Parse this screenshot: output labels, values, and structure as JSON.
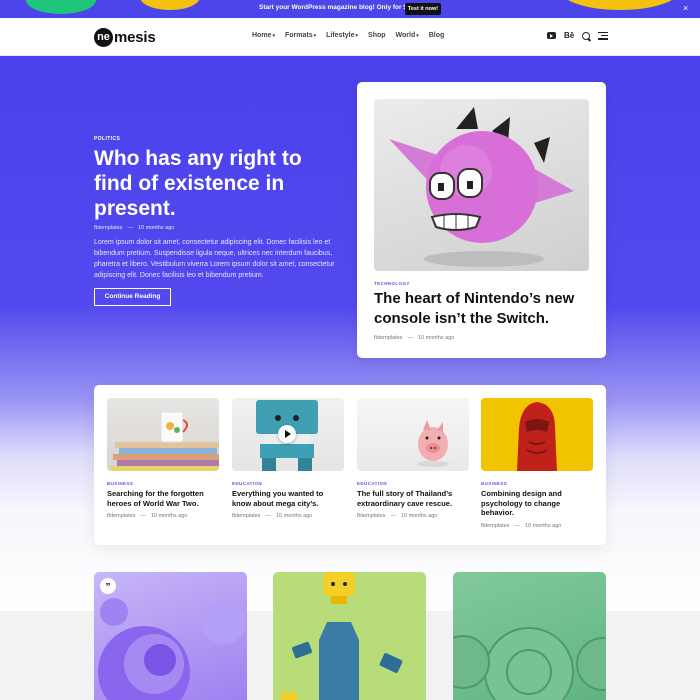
{
  "topbar": {
    "text": "Start your WordPress magazine blog! Only for $59",
    "button": "Test it now!",
    "close": "×"
  },
  "header": {
    "logo_mark": "ne",
    "logo_rest": "mesis",
    "nav": [
      "Home",
      "Formats",
      "Lifestyle",
      "Shop",
      "World",
      "Blog"
    ],
    "icons": [
      "youtube-icon",
      "behance-icon",
      "search-icon",
      "menu-icon"
    ],
    "behance_text": "Bē"
  },
  "hero": {
    "category": "POLITICS",
    "title": "Who has any right to find of existence in present.",
    "author": "fbtemplates",
    "time": "10 months ago",
    "excerpt": "Lorem ipsum dolor sit amet, consectetur adipiscing elit. Donec facilisis leo et bibendum pretium. Suspendisse ligula neque, ultrices nec interdum faucibus, pharetra et libero. Vestibulum viverra Lorem ipsum dolor sit amet, consectetur adipiscing elit. Donec facilisis leo et bibendum pretium.",
    "button": "Continue Reading"
  },
  "featured": {
    "category": "TECHNOLOGY",
    "title": "The heart of Nintendo’s new console isn’t the Switch.",
    "author": "fbtemplates",
    "time": "10 months ago"
  },
  "cards": [
    {
      "category": "BUSINESS",
      "title": "Searching for the forgotten heroes of World War Two.",
      "author": "fbtemplates",
      "time": "10 months ago"
    },
    {
      "category": "EDUCATION",
      "title": "Everything you wanted to know about mega city’s.",
      "author": "fbtemplates",
      "time": "10 months ago"
    },
    {
      "category": "EDUCATION",
      "title": "The full story of Thailand’s extraordinary cave rescue.",
      "author": "fbtemplates",
      "time": "10 months ago"
    },
    {
      "category": "BUSINESS",
      "title": "Combining design and psychology to change behavior.",
      "author": "fbtemplates",
      "time": "10 months ago"
    }
  ],
  "meta_separator": "—",
  "quote_badge": "”",
  "colors": {
    "accent": "#4a41ec",
    "category": "#5a55e8",
    "topbar_button": "#111111"
  }
}
